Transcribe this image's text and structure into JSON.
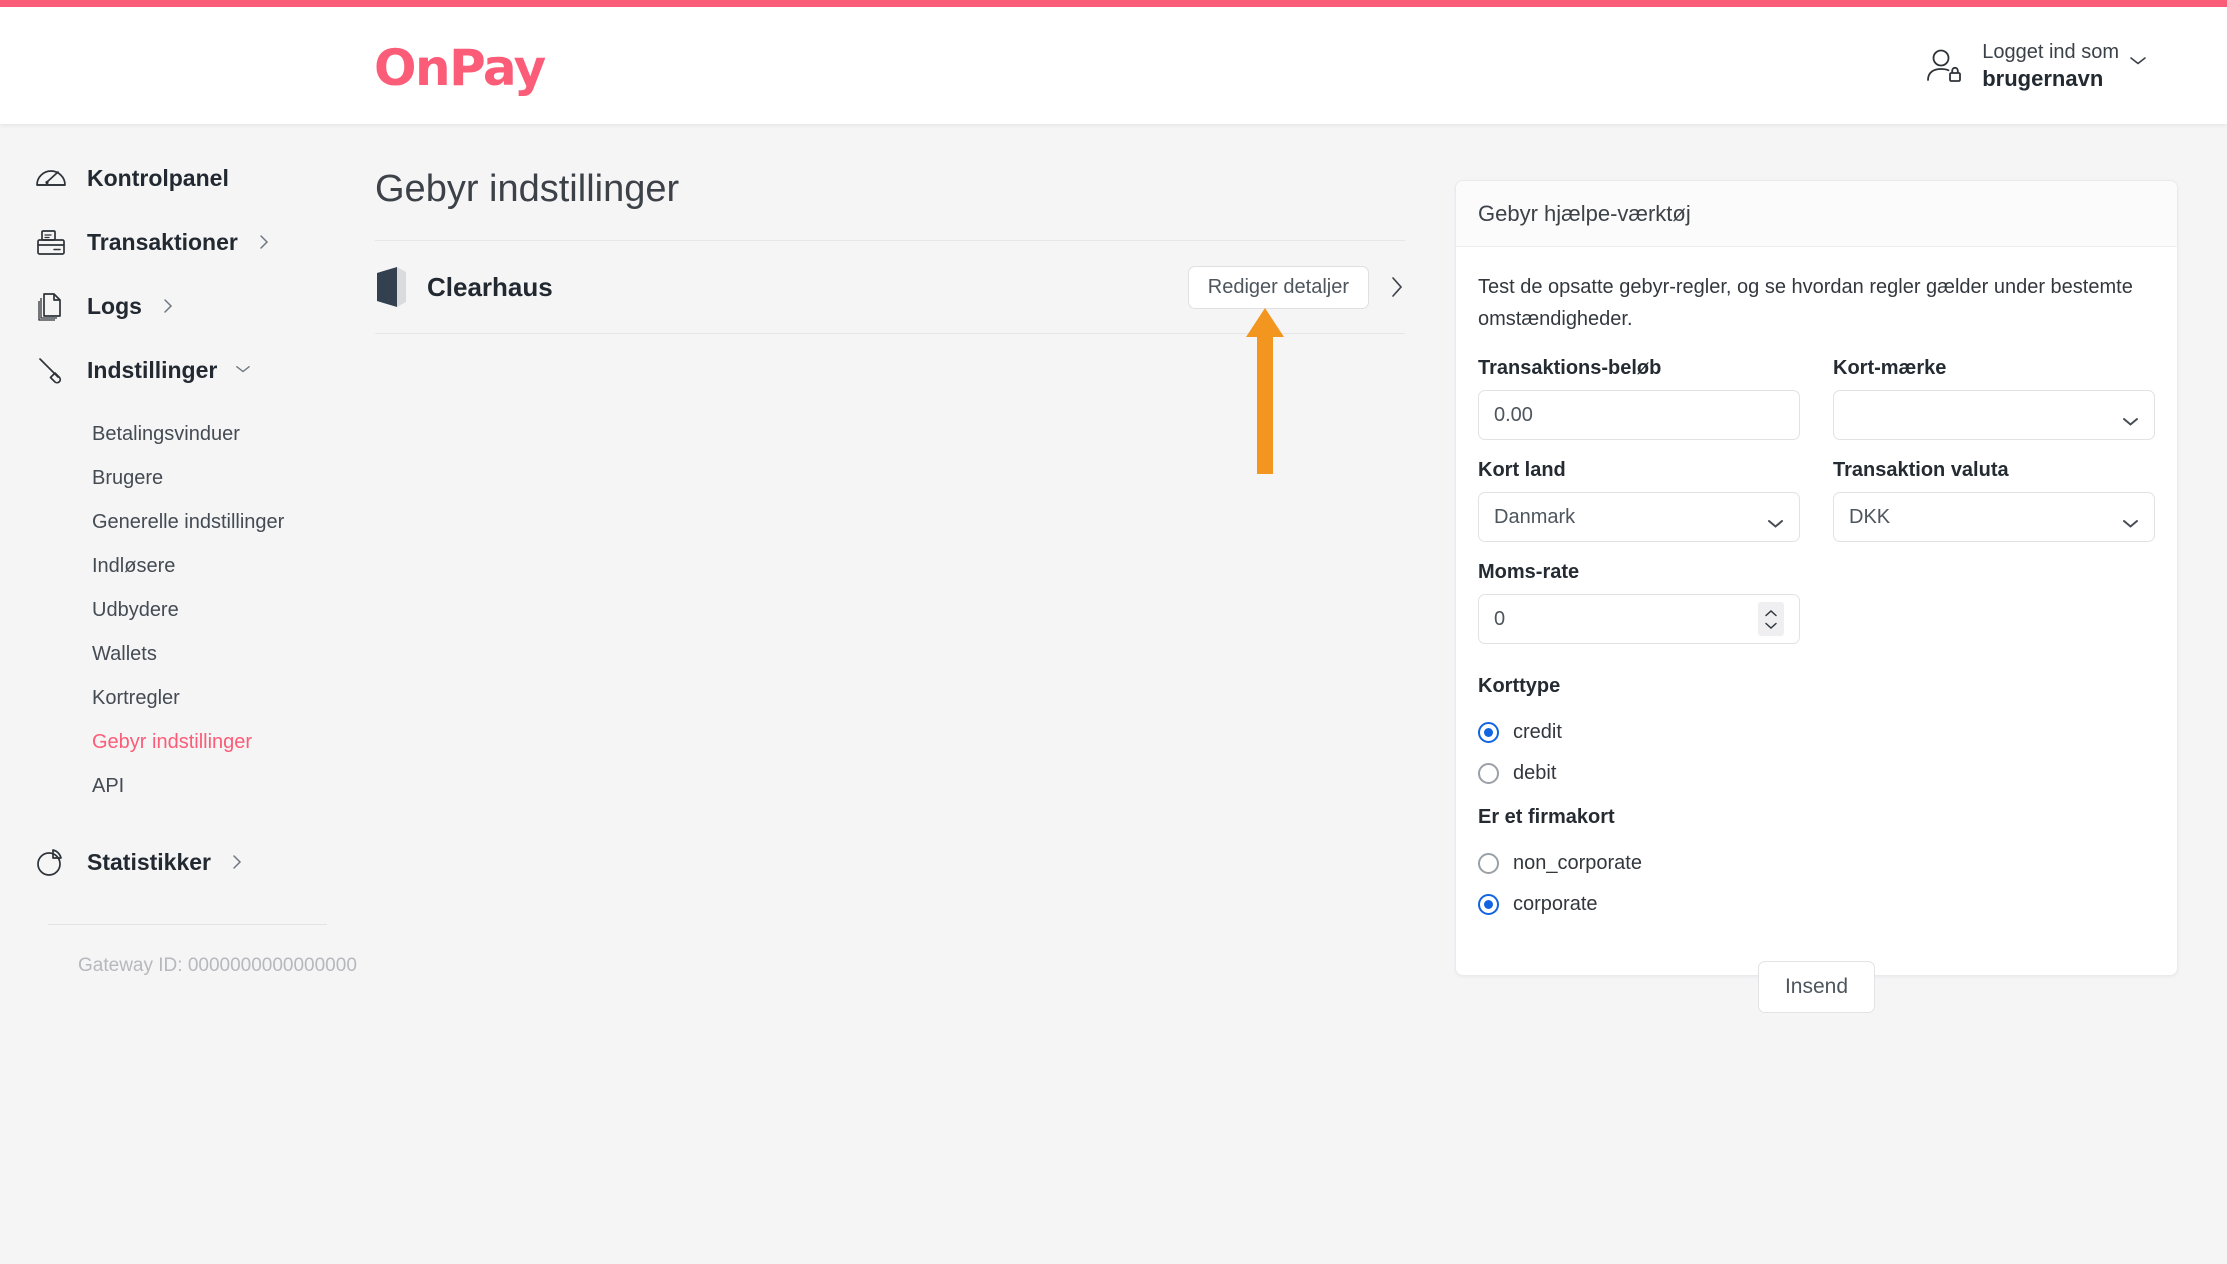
{
  "brand": {
    "logo_text": "OnPay",
    "accent_color": "#fb5c77"
  },
  "header": {
    "account_label": "Logget ind som",
    "account_name": "brugernavn"
  },
  "sidebar": {
    "main_items": [
      {
        "label": "Kontrolpanel",
        "icon": "gauge-icon",
        "arrow": "none"
      },
      {
        "label": "Transaktioner",
        "icon": "cash-register-icon",
        "arrow": "right"
      },
      {
        "label": "Logs",
        "icon": "documents-icon",
        "arrow": "right"
      },
      {
        "label": "Indstillinger",
        "icon": "pen-icon",
        "arrow": "down"
      }
    ],
    "sub_items": [
      {
        "label": "Betalingsvinduer",
        "active": false
      },
      {
        "label": "Brugere",
        "active": false
      },
      {
        "label": "Generelle indstillinger",
        "active": false
      },
      {
        "label": "Indløsere",
        "active": false
      },
      {
        "label": "Udbydere",
        "active": false
      },
      {
        "label": "Wallets",
        "active": false
      },
      {
        "label": "Kortregler",
        "active": false
      },
      {
        "label": "Gebyr indstillinger",
        "active": true
      },
      {
        "label": "API",
        "active": false
      }
    ],
    "statistics": {
      "label": "Statistikker",
      "icon": "pie-chart-icon",
      "arrow": "right"
    },
    "gateway_id": "Gateway ID: 0000000000000000"
  },
  "main": {
    "page_title": "Gebyr indstillinger",
    "acquirer": {
      "name": "Clearhaus",
      "edit_button": "Rediger detaljer",
      "chevron": "chevron-right-icon"
    }
  },
  "annotation": {
    "type": "arrow-up",
    "color": "#f3961f",
    "points_to": "Rediger detaljer"
  },
  "panel": {
    "title": "Gebyr hjælpe-værktøj",
    "description": "Test de opsatte gebyr-regler, og se hvordan regler gælder under bestemte omstændigheder.",
    "fields": [
      {
        "label": "Transaktions-beløb",
        "type": "text",
        "value": "0.00"
      },
      {
        "label": "Kort-mærke",
        "type": "select",
        "value": ""
      },
      {
        "label": "Kort land",
        "type": "select",
        "value": "Danmark"
      },
      {
        "label": "Transaktion valuta",
        "type": "select",
        "value": "DKK"
      },
      {
        "label": "Moms-rate",
        "type": "number",
        "value": "0"
      }
    ],
    "card_type": {
      "label": "Korttype",
      "options": [
        {
          "label": "credit",
          "selected": true
        },
        {
          "label": "debit",
          "selected": false
        }
      ]
    },
    "corporate": {
      "label": "Er et firmakort",
      "options": [
        {
          "label": "non_corporate",
          "selected": false
        },
        {
          "label": "corporate",
          "selected": true
        }
      ]
    },
    "submit_label": "Insend"
  }
}
